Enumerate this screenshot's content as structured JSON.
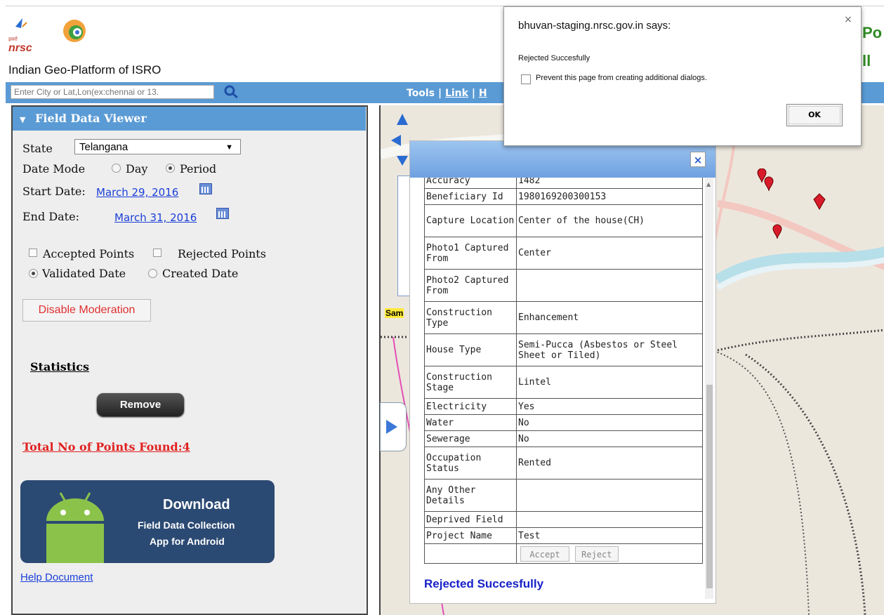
{
  "header": {
    "org_hindi": "इसरो",
    "org_abbr": "nrsc",
    "portal_name": "Indian Geo-Platform of ISRO",
    "right_text_1": "Po",
    "right_text_2": "ll"
  },
  "search": {
    "placeholder": "Enter City or Lat,Lon(ex:chennai or 13."
  },
  "menu": {
    "tools": "Tools",
    "sep": "|",
    "link": "Link",
    "h": "H"
  },
  "panel": {
    "title": "Field Data Viewer",
    "state_label": "State",
    "state_value": "Telangana",
    "date_mode_label": "Date Mode",
    "day_label": "Day",
    "period_label": "Period",
    "start_date_label": "Start Date:",
    "start_date_value": "March 29, 2016",
    "end_date_label": "End Date:",
    "end_date_value": "March 31, 2016",
    "accepted_label": "Accepted Points",
    "rejected_label": "Rejected Points",
    "validated_label": "Validated Date",
    "created_label": "Created Date",
    "disable_btn": "Disable Moderation",
    "statistics": "Statistics",
    "remove_btn": "Remove",
    "total_points": "Total No of Points Found:4",
    "banner_title": "Download",
    "banner_line1": "Field Data Collection",
    "banner_line2": "App for Android",
    "help_doc": "Help Document"
  },
  "map": {
    "sam_label": "Sam"
  },
  "popup": {
    "close": "×",
    "rows": [
      {
        "key": "Accuracy",
        "value": "1482"
      },
      {
        "key": "Beneficiary Id",
        "value": "1980169200300153"
      },
      {
        "key": "Capture Location",
        "value": "Center of the house(CH)"
      },
      {
        "key": "Photo1 Captured From",
        "value": "Center"
      },
      {
        "key": "Photo2 Captured From",
        "value": ""
      },
      {
        "key": "Construction Type",
        "value": "Enhancement"
      },
      {
        "key": "House Type",
        "value": "Semi-Pucca (Asbestos or Steel Sheet or Tiled)"
      },
      {
        "key": "Construction Stage",
        "value": "Lintel"
      },
      {
        "key": "Electricity",
        "value": "Yes"
      },
      {
        "key": "Water",
        "value": "No"
      },
      {
        "key": "Sewerage",
        "value": "No"
      },
      {
        "key": "Occupation Status",
        "value": "Rented"
      },
      {
        "key": "Any Other Details",
        "value": ""
      },
      {
        "key": "Deprived Field",
        "value": ""
      },
      {
        "key": "Project Name",
        "value": "Test"
      }
    ],
    "accept_btn": "Accept",
    "reject_btn": "Reject",
    "status_msg": "Rejected Succesfully"
  },
  "dialog": {
    "title": "bhuvan-staging.nrsc.gov.in says:",
    "message": "Rejected Succesfully",
    "checkbox_label": "Prevent this page from creating additional dialogs.",
    "ok_btn": "OK",
    "close": "×"
  },
  "colors": {
    "accent_blue": "#5b9bd5",
    "link_blue": "#1a3fd8",
    "error_red": "#e02020",
    "banner_navy": "#2b4a73"
  }
}
